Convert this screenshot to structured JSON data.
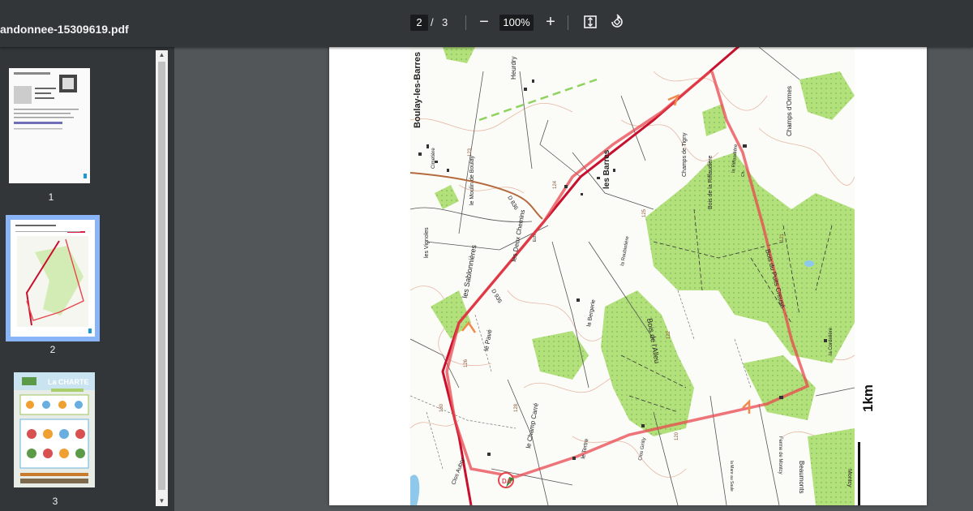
{
  "toolbar": {
    "filename": "andonnee-15309619.pdf",
    "current_page": "2",
    "page_separator": "/",
    "total_pages": "3",
    "zoom_out_icon": "−",
    "zoom_level": "100%",
    "zoom_in_icon": "+",
    "fit_icon": "fit-page-icon",
    "rotate_icon": "rotate-icon"
  },
  "thumbnails": [
    {
      "number": "1",
      "selected": false
    },
    {
      "number": "2",
      "selected": true
    },
    {
      "number": "3",
      "selected": false
    }
  ],
  "thumbnail_3": {
    "heading": "La CHARTE"
  },
  "map": {
    "place_labels": [
      "Boulay-les-Barres",
      "les Barres",
      "Heurdry",
      "le Moulin de Boulay",
      "les Vignoles",
      "les Sablonnières",
      "les Deux Chemins",
      "le Pavé",
      "Clos Aubry",
      "le Champ Carré",
      "le Tertre",
      "la Bergerie",
      "la Roubiotière",
      "Bois de l'Alleu",
      "Bois de la Riffaudière",
      "Bois du Puits Creusé",
      "la Riffaudière",
      "Champs de Tigny",
      "Champs d'Ormes",
      "la Cordelière",
      "Ferme de Montcy",
      "Beaumonts",
      "la Mare au Saule",
      "Montcy",
      "Clos Girilly",
      "Cimetière",
      "D 836",
      "D 935",
      "Ech.",
      "Ch."
    ],
    "elevations": [
      "123",
      "124",
      "125",
      "126",
      "120",
      "121",
      "122",
      "128",
      "130"
    ],
    "marker_label": "DA",
    "scale_label": "1km"
  },
  "colors": {
    "toolbar_bg": "#323639",
    "viewer_bg": "#525659",
    "route": "#e8474f",
    "road": "#c8102e",
    "forest": "#b2e07a",
    "selected_outline": "#8ab4f8"
  }
}
